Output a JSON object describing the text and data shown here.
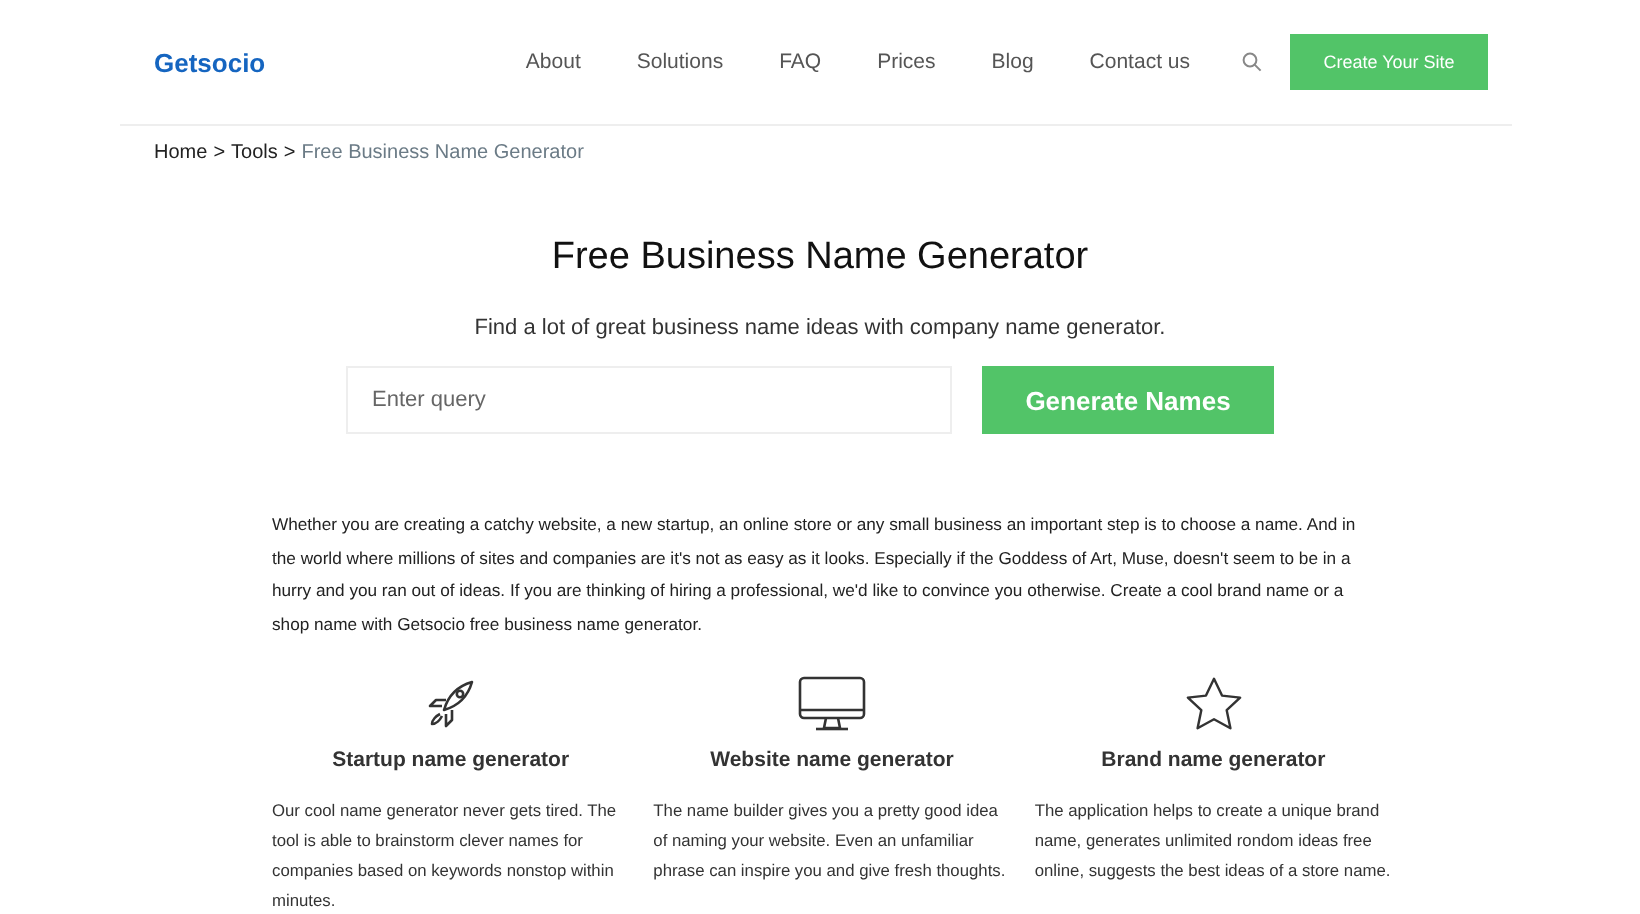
{
  "header": {
    "logo": "Getsocio",
    "nav": [
      "About",
      "Solutions",
      "FAQ",
      "Prices",
      "Blog",
      "Contact us"
    ],
    "cta": "Create Your Site"
  },
  "breadcrumb": {
    "links": [
      "Home",
      "Tools"
    ],
    "separator": ">",
    "current": "Free Business Name Generator"
  },
  "hero": {
    "title": "Free Business Name Generator",
    "subtitle": "Find a lot of great business name ideas with company name generator.",
    "search": {
      "placeholder": "Enter query"
    },
    "button": "Generate Names"
  },
  "intro": "Whether you are creating a catchy website, a new startup, an online store or any small business an important step is to choose a name. And in the world where millions of sites and companies are it's not as easy as it looks. Especially if the Goddess of Art, Muse, doesn't seem to be in a hurry and you ran out of ideas. If you are thinking of hiring a professional, we'd like to convince you otherwise. Create a cool brand name or a shop name with Getsocio free business name generator.",
  "features": [
    {
      "kind": "rocket",
      "title": "Startup name generator",
      "text": "Our cool name generator never gets tired. The tool is able to brainstorm clever names for companies based on keywords nonstop within minutes."
    },
    {
      "kind": "monitor",
      "title": "Website name generator",
      "text": "The name builder gives you a pretty good idea of naming your website. Even an unfamiliar phrase can inspire you and give fresh thoughts."
    },
    {
      "kind": "star",
      "title": "Brand name generator",
      "text": "The application helps to create a unique brand name, generates unlimited rondom ideas free online, suggests the best ideas of a store name."
    }
  ]
}
